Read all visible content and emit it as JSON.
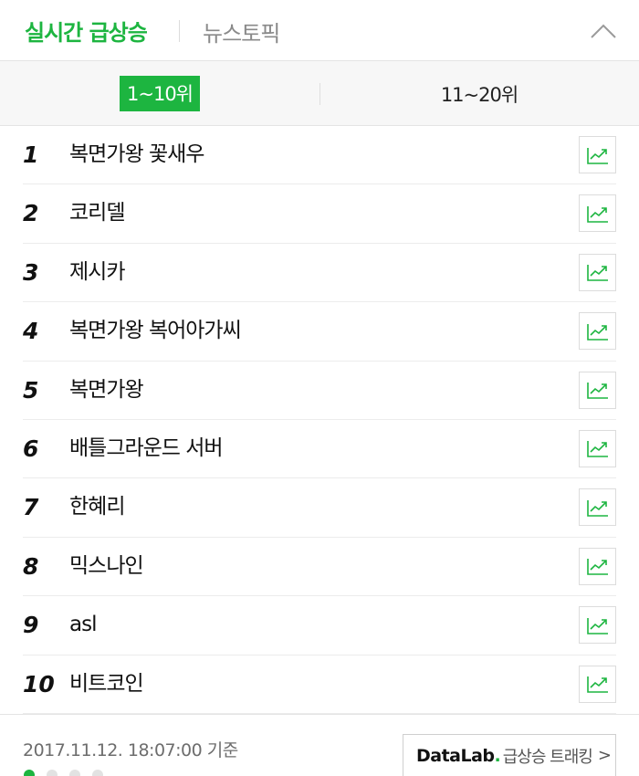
{
  "header": {
    "title": "실시간 급상승",
    "news_tab": "뉴스토픽",
    "collapse_icon": "chevron-up-icon"
  },
  "subtabs": {
    "first": "1~10위",
    "second": "11~20위"
  },
  "ranking": [
    {
      "rank": "1",
      "keyword": "복면가왕 꽃새우"
    },
    {
      "rank": "2",
      "keyword": "코리델"
    },
    {
      "rank": "3",
      "keyword": "제시카"
    },
    {
      "rank": "4",
      "keyword": "복면가왕 복어아가씨"
    },
    {
      "rank": "5",
      "keyword": "복면가왕"
    },
    {
      "rank": "6",
      "keyword": "배틀그라운드 서버"
    },
    {
      "rank": "7",
      "keyword": "한혜리"
    },
    {
      "rank": "8",
      "keyword": "믹스나인"
    },
    {
      "rank": "9",
      "keyword": "asl"
    },
    {
      "rank": "10",
      "keyword": "비트코인"
    }
  ],
  "footer": {
    "timestamp": "2017.11.12. 18:07:00 기준",
    "datalab_brand": "DataLab",
    "datalab_dot": ".",
    "datalab_text": "급상승 트래킹",
    "datalab_chevron": ">",
    "page_count": 4,
    "active_page": 1
  },
  "colors": {
    "accent": "#1db540",
    "text": "#111111",
    "muted": "#8a8a8a"
  }
}
